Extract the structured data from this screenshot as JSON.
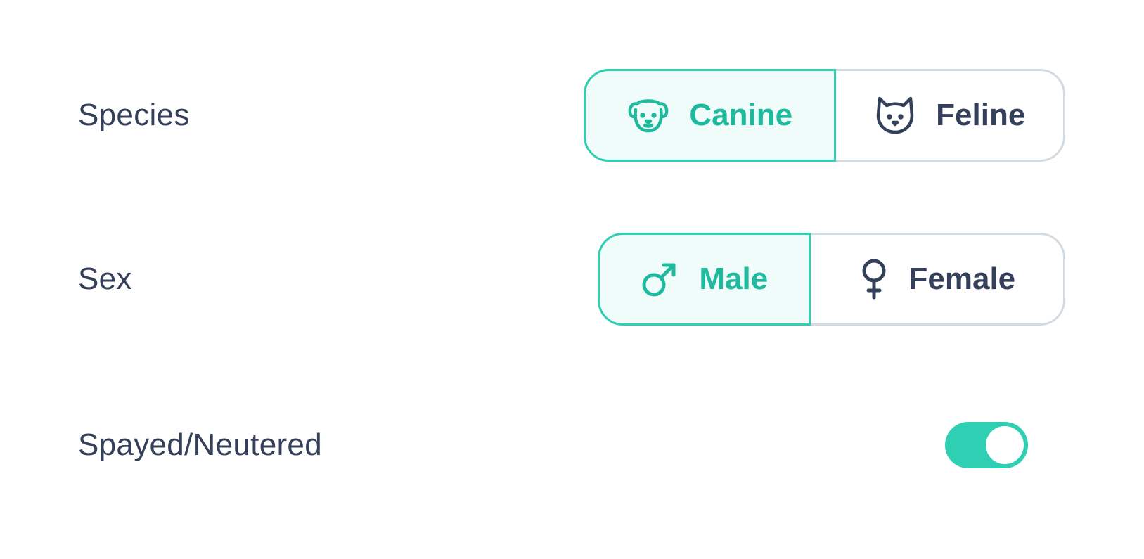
{
  "species": {
    "label": "Species",
    "options": [
      {
        "label": "Canine",
        "icon": "dog-icon",
        "selected": true
      },
      {
        "label": "Feline",
        "icon": "cat-icon",
        "selected": false
      }
    ]
  },
  "sex": {
    "label": "Sex",
    "options": [
      {
        "label": "Male",
        "icon": "male-symbol-icon",
        "selected": true
      },
      {
        "label": "Female",
        "icon": "female-symbol-icon",
        "selected": false
      }
    ]
  },
  "spayed_neutered": {
    "label": "Spayed/Neutered",
    "enabled": true
  },
  "colors": {
    "accent": "#2ECFB2",
    "accent_text": "#1FB99E",
    "selected_bg": "#EFFCF9",
    "text": "#34405A",
    "border": "#D3DBE2"
  }
}
